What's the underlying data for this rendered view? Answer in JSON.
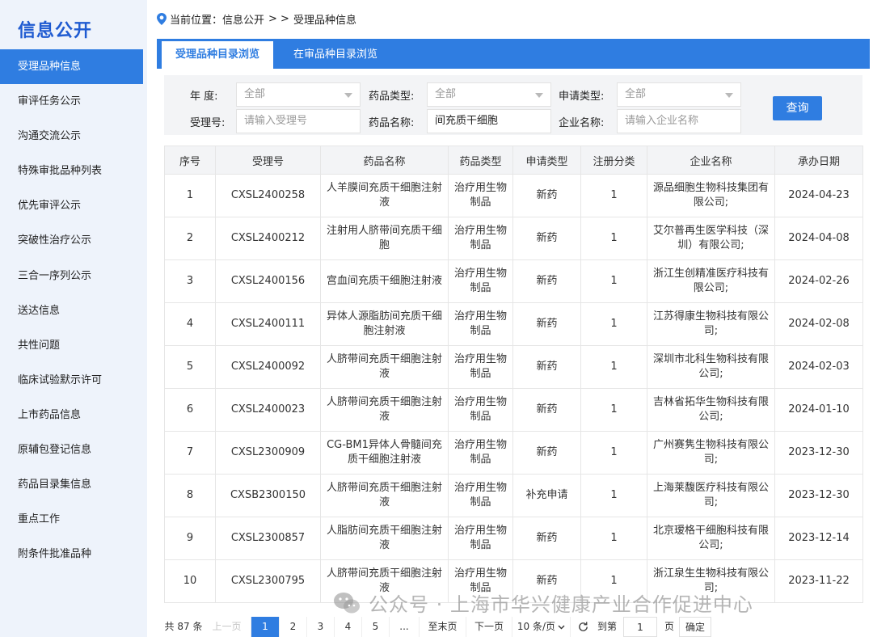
{
  "sidebar": {
    "title": "信息公开",
    "items": [
      {
        "label": "受理品种信息",
        "active": true
      },
      {
        "label": "审评任务公示"
      },
      {
        "label": "沟通交流公示"
      },
      {
        "label": "特殊审批品种列表"
      },
      {
        "label": "优先审评公示"
      },
      {
        "label": "突破性治疗公示"
      },
      {
        "label": "三合一序列公示"
      },
      {
        "label": "送达信息"
      },
      {
        "label": "共性问题"
      },
      {
        "label": "临床试验默示许可"
      },
      {
        "label": "上市药品信息"
      },
      {
        "label": "原辅包登记信息"
      },
      {
        "label": "药品目录集信息"
      },
      {
        "label": "重点工作"
      },
      {
        "label": "附条件批准品种"
      }
    ]
  },
  "breadcrumb": {
    "prefix": "当前位置：",
    "path1": "信息公开",
    "sep": "> >",
    "path2": "受理品种信息"
  },
  "tabs": [
    {
      "label": "受理品种目录浏览",
      "active": true
    },
    {
      "label": "在审品种目录浏览"
    }
  ],
  "filters": {
    "year_label": "年    度:",
    "year_value": "全部",
    "drug_type_label": "药品类型:",
    "drug_type_value": "全部",
    "apply_type_label": "申请类型:",
    "apply_type_value": "全部",
    "accept_no_label": "受理号:",
    "accept_no_placeholder": "请输入受理号",
    "drug_name_label": "药品名称:",
    "drug_name_value": "间充质干细胞",
    "company_label": "企业名称:",
    "company_placeholder": "请输入企业名称",
    "query_label": "查询"
  },
  "table": {
    "headers": [
      "序号",
      "受理号",
      "药品名称",
      "药品类型",
      "申请类型",
      "注册分类",
      "企业名称",
      "承办日期"
    ],
    "rows": [
      [
        "1",
        "CXSL2400258",
        "人羊膜间充质干细胞注射液",
        "治疗用生物制品",
        "新药",
        "1",
        "源品细胞生物科技集团有限公司;",
        "2024-04-23"
      ],
      [
        "2",
        "CXSL2400212",
        "注射用人脐带间充质干细胞",
        "治疗用生物制品",
        "新药",
        "1",
        "艾尔普再生医学科技（深圳）有限公司;",
        "2024-04-08"
      ],
      [
        "3",
        "CXSL2400156",
        "宫血间充质干细胞注射液",
        "治疗用生物制品",
        "新药",
        "1",
        "浙江生创精准医疗科技有限公司;",
        "2024-02-26"
      ],
      [
        "4",
        "CXSL2400111",
        "异体人源脂肪间充质干细胞注射液",
        "治疗用生物制品",
        "新药",
        "1",
        "江苏得康生物科技有限公司;",
        "2024-02-08"
      ],
      [
        "5",
        "CXSL2400092",
        "人脐带间充质干细胞注射液",
        "治疗用生物制品",
        "新药",
        "1",
        "深圳市北科生物科技有限公司;",
        "2024-02-03"
      ],
      [
        "6",
        "CXSL2400023",
        "人脐带间充质干细胞注射液",
        "治疗用生物制品",
        "新药",
        "1",
        "吉林省拓华生物科技有限公司;",
        "2024-01-10"
      ],
      [
        "7",
        "CXSL2300909",
        "CG-BM1异体人骨髓间充质干细胞注射液",
        "治疗用生物制品",
        "新药",
        "1",
        "广州赛隽生物科技有限公司;",
        "2023-12-30"
      ],
      [
        "8",
        "CXSB2300150",
        "人脐带间充质干细胞注射液",
        "治疗用生物制品",
        "补充申请",
        "1",
        "上海莱馥医疗科技有限公司;",
        "2023-12-30"
      ],
      [
        "9",
        "CXSL2300857",
        "人脂肪间充质干细胞注射液",
        "治疗用生物制品",
        "新药",
        "1",
        "北京瑷格干细胞科技有限公司;",
        "2023-12-14"
      ],
      [
        "10",
        "CXSL2300795",
        "人脐带间充质干细胞注射液",
        "治疗用生物制品",
        "新药",
        "1",
        "浙江泉生生物科技有限公司;",
        "2023-11-22"
      ]
    ]
  },
  "pagination": {
    "total": "共 87 条",
    "prev": "上一页",
    "pages": [
      "1",
      "2",
      "3",
      "4",
      "5"
    ],
    "ellipsis": "...",
    "last": "至末页",
    "next": "下一页",
    "page_size": "10 条/页",
    "goto_label": "到第",
    "goto_value": "1",
    "page_unit": "页",
    "confirm": "确定"
  },
  "watermark": "公众号 · 上海市华兴健康产业合作促进中心",
  "colors": {
    "accent": "#2f7de1",
    "sidebar_bg": "#eef3fb",
    "title": "#1f5bd1"
  }
}
